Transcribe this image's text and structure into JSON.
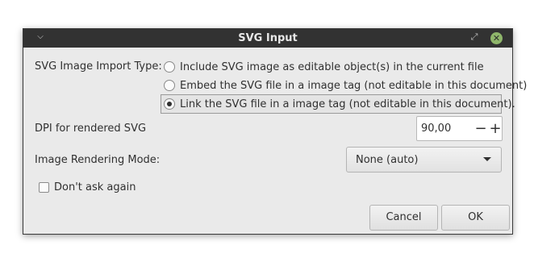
{
  "window": {
    "title": "SVG Input",
    "titlebar_menu_icon": "chevron-down-icon",
    "titlebar_restore_icon": "restore-icon",
    "titlebar_close_glyph": "✕"
  },
  "import_type": {
    "label": "SVG Image Import Type:",
    "options": [
      {
        "label": "Include SVG image as editable object(s) in the current file",
        "checked": false
      },
      {
        "label": "Embed the SVG file in a image tag (not editable in this document)",
        "checked": false
      },
      {
        "label": "Link the SVG file in a image tag (not editable in this document).",
        "checked": true
      }
    ]
  },
  "dpi": {
    "label": "DPI for rendered SVG",
    "value": "90,00",
    "minus": "−",
    "plus": "+"
  },
  "rendering_mode": {
    "label": "Image Rendering Mode:",
    "selected": "None (auto)"
  },
  "dont_ask": {
    "label": "Don't ask again",
    "checked": false
  },
  "buttons": {
    "cancel": "Cancel",
    "ok": "OK"
  },
  "colors": {
    "titlebar_bg": "#323232",
    "dialog_bg": "#eaeaea",
    "close_button": "#8fb66b"
  }
}
